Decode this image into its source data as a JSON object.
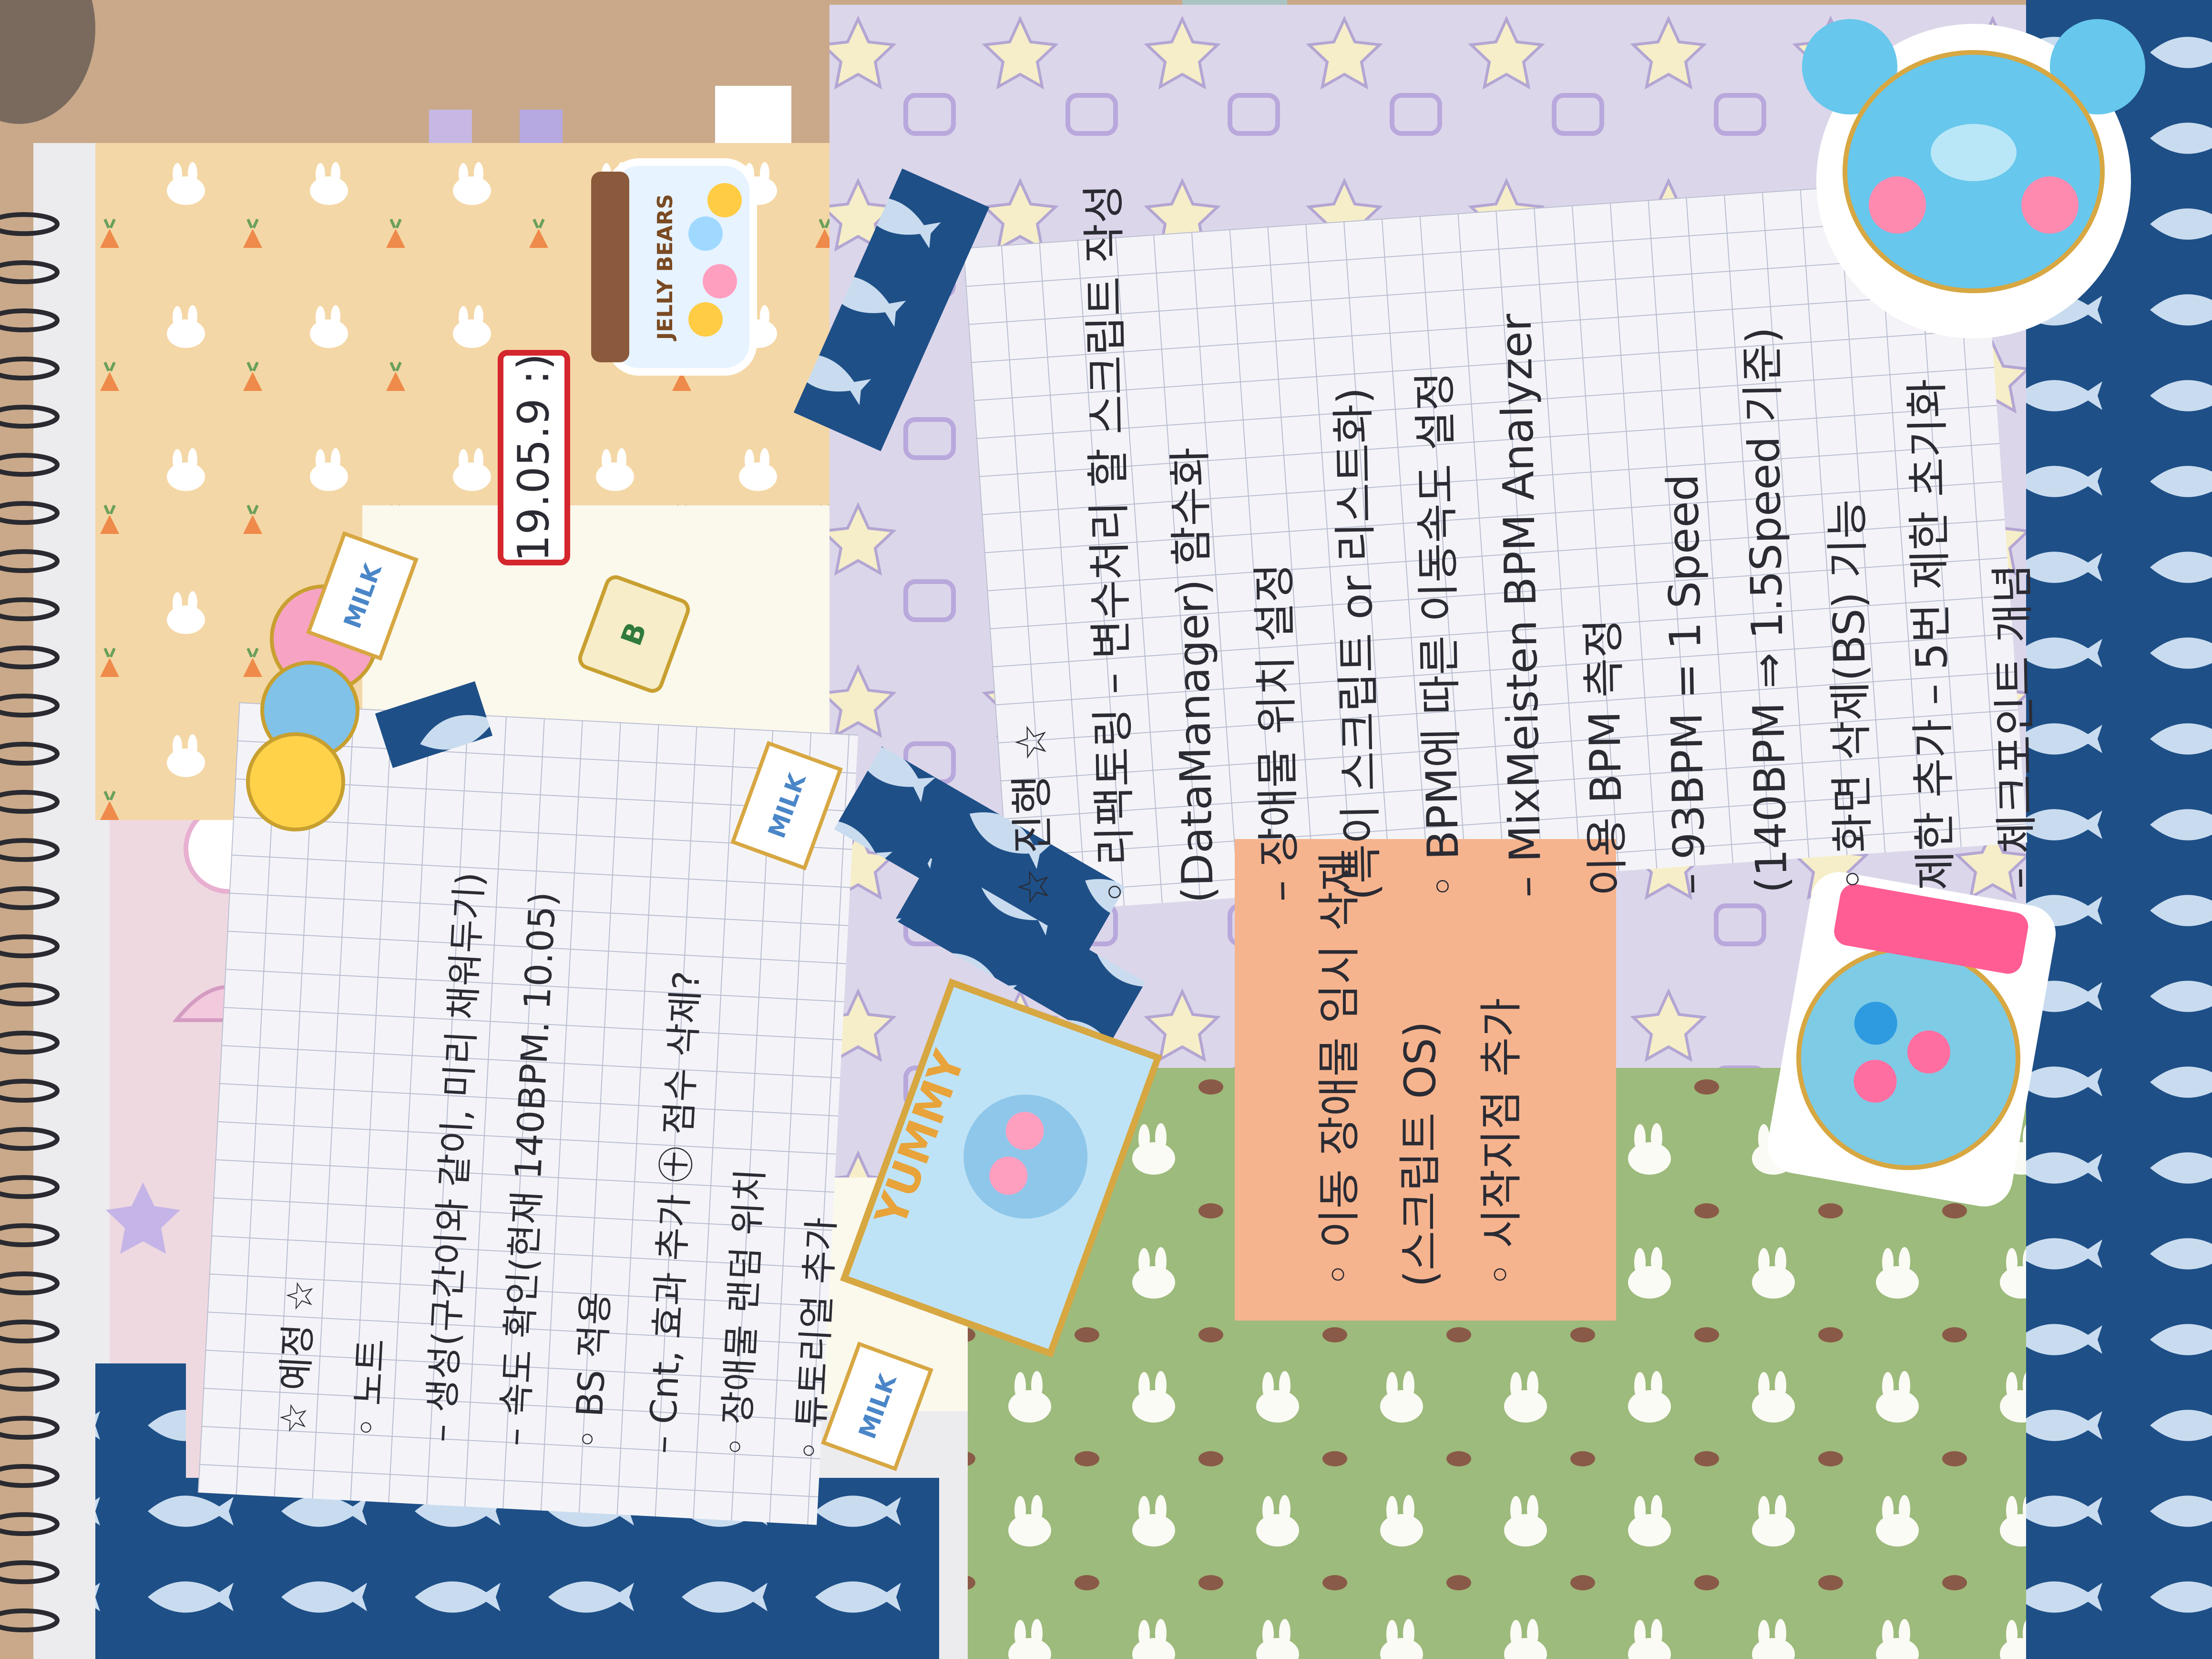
{
  "date_label": "19.05.9 :)",
  "sticker_jar": "JELLY BEARS",
  "sticker_yummy": "YUMMY",
  "milk_labels": [
    "MILK",
    "MILK",
    "MILK"
  ],
  "bottle_letter": "B",
  "note_left": {
    "lines": [
      "☆ 예정 ☆",
      "◦ 노트",
      "– 생성(구간이와 같이, 미리 채워두기)",
      "– 속도 확인(현재 140BPM. 10.05)",
      "◦ BS 적용",
      "– Cnt, 효과 추가 ㊉ 점수 삭제?",
      "◦ 장애물 랜덤 위치",
      "◦ 튜토리얼 추가"
    ]
  },
  "note_right": {
    "lines": [
      "☆ 진행 ☆",
      "◦ 리팩토링 – 변수처리 할 스크립트 작성",
      "(DataManager) 함수화",
      "– 장애물 위치 설정",
      "(특이 스크립트 or 리스트화)",
      "◦ BPM에 따른 이동속도 설정",
      "– MixMeisten BPM Analyzer",
      "이용 BPM 측정",
      "– 93BPM = 1 Speed",
      "(140BPM ⇒ 1.5Speed 기준)",
      "◦ 화면 삭제(BS) 기능",
      "제한 추가 – 5번 제한 초기화",
      "– 체크포인트 개념"
    ]
  },
  "sticky_note": {
    "lines": [
      "◦ 이동 장애물 임시 삭제",
      "(스크립트 OS)",
      "◦ 시작지점 추가"
    ]
  },
  "colors": {
    "background": "#c9a98a",
    "paper": "#f1f0f4",
    "peach_paper": "#f4d7a6",
    "lavender_paper": "#dcd6ea",
    "green_paper": "#9dbb7c",
    "sticky": "#f6b48e",
    "washi_tape": "#1e4f87",
    "spiral": "#2a2a30"
  },
  "icons": [
    "spiral-binding-icon",
    "jelly-bear-jar-icon",
    "gummy-bears-icon",
    "blue-bear-sticker-icon",
    "gumball-machine-icon",
    "yummy-box-icon",
    "milk-carton-icon",
    "bunny-pattern-icon",
    "whale-pattern-icon"
  ]
}
